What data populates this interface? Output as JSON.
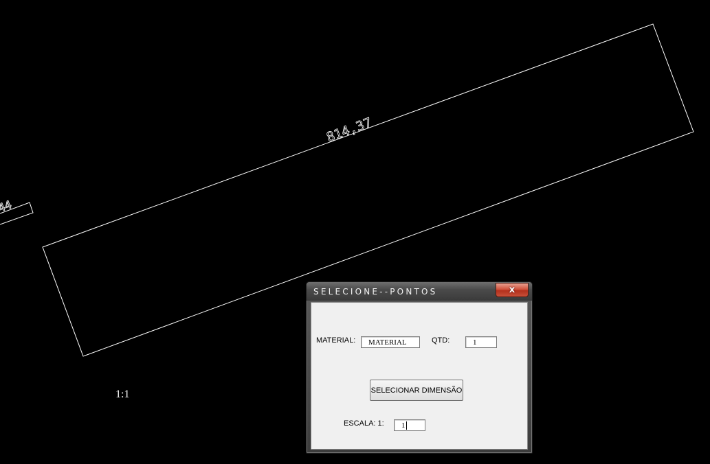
{
  "canvas": {
    "dimension_main": "814,37",
    "dimension_partial": "44",
    "scale_text": "1:1"
  },
  "dialog": {
    "title": "SELECIONE--PONTOS",
    "close_glyph": "x",
    "material_label": "MATERIAL:",
    "material_value": "MATERIAL",
    "qtd_label": "QTD:",
    "qtd_value": "1",
    "select_button": "SELECIONAR DIMENSÃO",
    "scale_label": "ESCALA: 1:",
    "scale_value": "1"
  }
}
